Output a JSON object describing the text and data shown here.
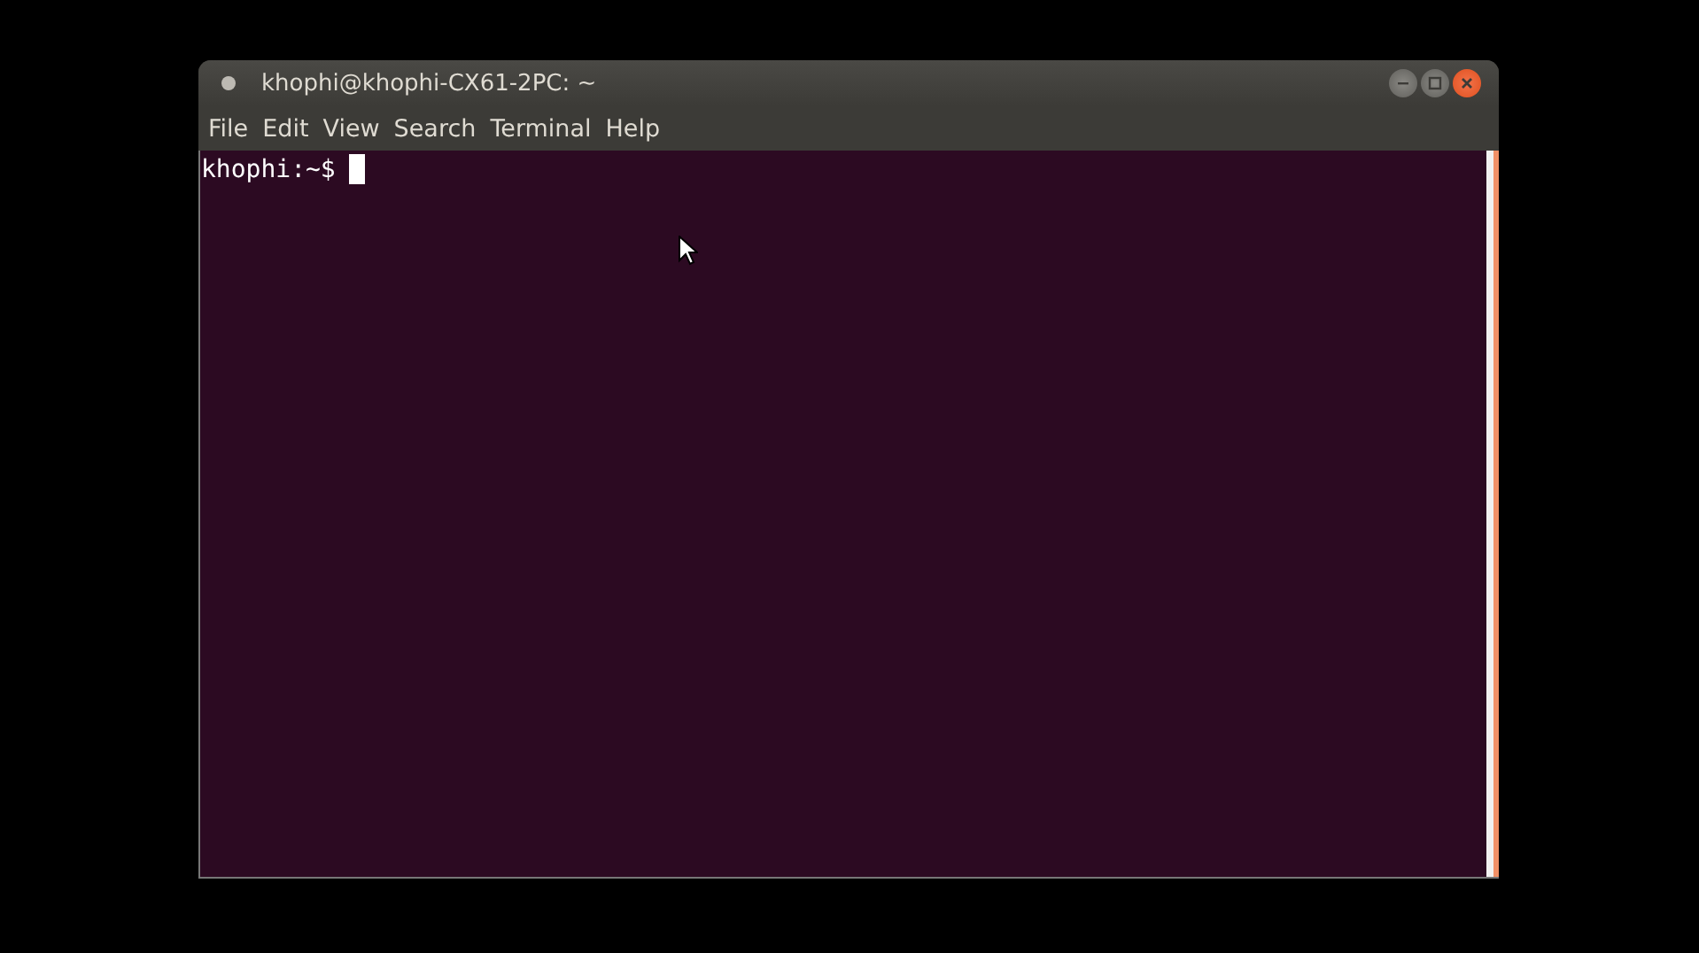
{
  "window": {
    "title": "khophi@khophi-CX61-2PC: ~"
  },
  "menu": [
    "File",
    "Edit",
    "View",
    "Search",
    "Terminal",
    "Help"
  ],
  "terminal": {
    "prompt": "khophi:~$"
  }
}
